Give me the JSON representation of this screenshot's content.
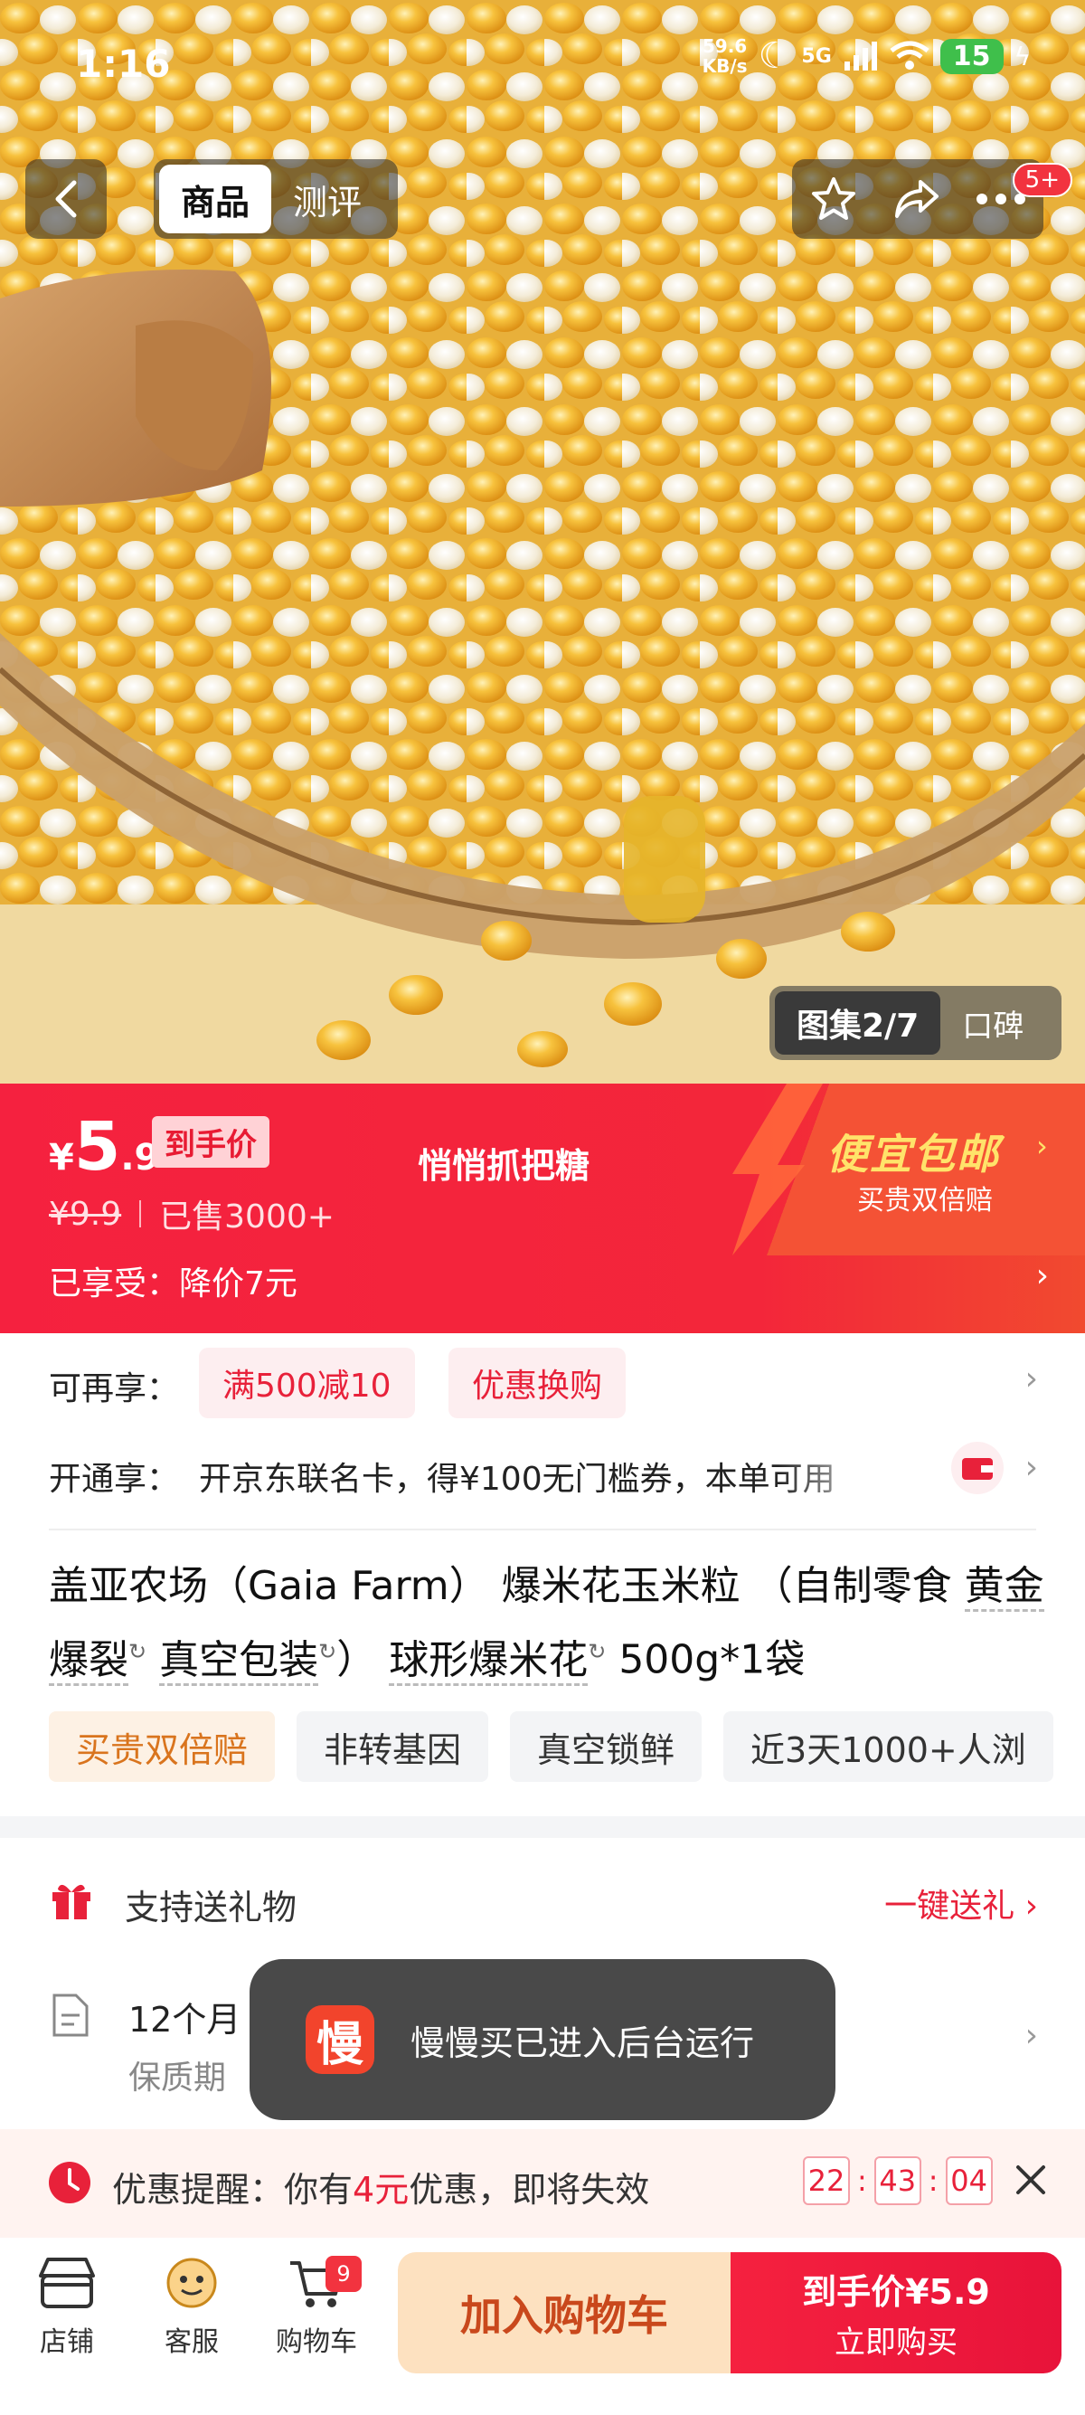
{
  "status_bar": {
    "time": "1:16",
    "net_speed_value": "59.6",
    "net_speed_unit": "KB/s",
    "network": "5G",
    "battery": "15"
  },
  "nav": {
    "tabs": [
      {
        "label": "商品",
        "active": true
      },
      {
        "label": "测评",
        "active": false
      }
    ],
    "message_badge": "5+"
  },
  "gallery": {
    "counter": "图集2/7",
    "reviews_tab": "口碑"
  },
  "price": {
    "currency": "¥",
    "integer": "5",
    "decimal": ".9",
    "tag": "到手价",
    "original_price": "¥9.9",
    "sold": "已售3000+",
    "slogan": "悄悄抓把糖",
    "enjoyed": "已享受：降价7元",
    "promo_title": "便宜包邮",
    "promo_sub": "买贵双倍赔"
  },
  "coupons": {
    "label": "可再享：",
    "items": [
      "满500减10",
      "优惠换购"
    ]
  },
  "card_offer": {
    "label": "开通享：",
    "text": "开京东联名卡，得¥100无门槛券，本单可用"
  },
  "title": {
    "part1": "盖亚农场（Gaia Farm） 爆米花玉米粒 （自制零食 ",
    "kw1": "黄金爆裂",
    "kw2": "真空包装",
    "close": "）",
    "kw3": "球形爆米花",
    "spec": " 500g*1袋"
  },
  "tags": [
    "买贵双倍赔",
    "非转基因",
    "真空锁鲜",
    "近3天1000+人浏"
  ],
  "gift": {
    "label": "支持送礼物",
    "link": "一键送礼"
  },
  "shelf_life": {
    "value": "12个月",
    "label": "保质期"
  },
  "toast": {
    "logo_char": "慢",
    "text": "慢慢买已进入后台运行"
  },
  "reminder": {
    "prefix": "优惠提醒：你有",
    "amount": "4元",
    "suffix": "优惠，即将失效",
    "countdown": [
      "22",
      "43",
      "04"
    ]
  },
  "bottom_bar": {
    "store": "店铺",
    "service": "客服",
    "cart": "购物车",
    "cart_count": "9",
    "add_to_cart": "加入购物车",
    "buy_top": "到手价¥5.9",
    "buy_bottom": "立即购买"
  },
  "colors": {
    "brand_red": "#f5213f",
    "promo_yellow": "#ffe36a",
    "cart_button_bg": "#fde1c0"
  }
}
